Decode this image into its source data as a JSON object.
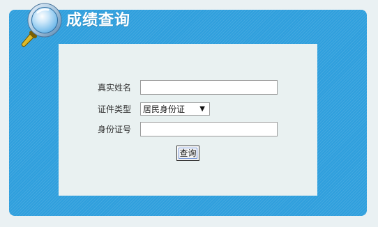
{
  "header": {
    "title": "成绩查询",
    "icon": "magnifying-glass-icon"
  },
  "form": {
    "real_name": {
      "label": "真实姓名",
      "value": "",
      "placeholder": ""
    },
    "id_type": {
      "label": "证件类型",
      "selected": "居民身份证"
    },
    "id_number": {
      "label": "身份证号",
      "value": "",
      "placeholder": ""
    },
    "submit_label": "查询"
  },
  "colors": {
    "panel_blue": "#2f9fdd",
    "card_bg": "#e9f1f1",
    "page_bg": "#eaf1f3"
  }
}
